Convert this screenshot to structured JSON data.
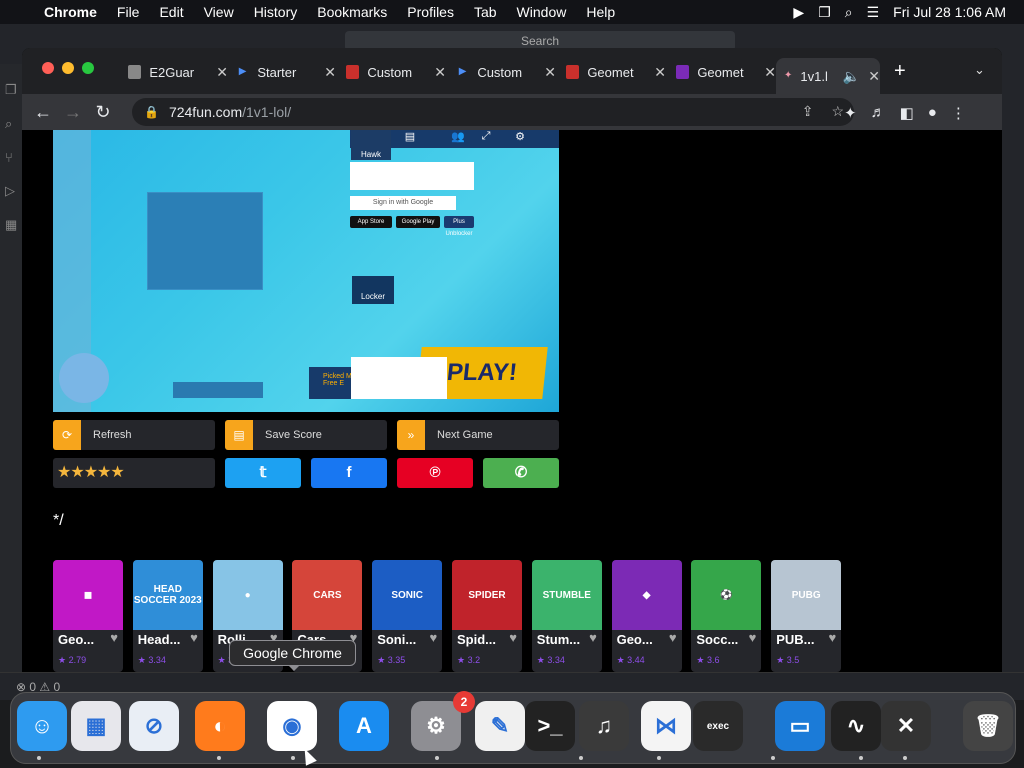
{
  "menubar": {
    "app": "Chrome",
    "items": [
      "File",
      "Edit",
      "View",
      "History",
      "Bookmarks",
      "Profiles",
      "Tab",
      "Window",
      "Help"
    ],
    "datetime": "Fri Jul 28  1:06 AM"
  },
  "bgapp": {
    "search_placeholder": "Search",
    "status": "⊗ 0 ⚠ 0"
  },
  "tabs": [
    {
      "title": "E2Guar",
      "icon": "globe-icon"
    },
    {
      "title": "Starter",
      "icon": "play-icon"
    },
    {
      "title": "Custom",
      "icon": "roblox-icon"
    },
    {
      "title": "Custom",
      "icon": "play-icon"
    },
    {
      "title": "Geomet",
      "icon": "roblox-icon"
    },
    {
      "title": "Geomet",
      "icon": "geometry-icon"
    },
    {
      "title": "1v1.l",
      "icon": "game-icon"
    }
  ],
  "url": {
    "host": "724fun.com",
    "path": "/1v1-lol/"
  },
  "game": {
    "avatar_label": "Hawk",
    "sign_in": "Sign in with Google",
    "app_store": "App Store",
    "google_play": "Google Play",
    "unblocker": "Plus Unblocker",
    "locker": "Locker",
    "play": "PLAY!",
    "picked": "Picked M Free E"
  },
  "controls": [
    {
      "label": "Refresh",
      "icon": "⟳"
    },
    {
      "label": "Save Score",
      "icon": "▤"
    },
    {
      "label": "Next Game",
      "icon": "»"
    }
  ],
  "stars": "★★★★★",
  "share": [
    {
      "name": "twitter",
      "icon": "🐦",
      "color": "#1da1f2"
    },
    {
      "name": "facebook",
      "icon": "f",
      "color": "#1877f2"
    },
    {
      "name": "pinterest",
      "icon": "℗",
      "color": "#e60023"
    },
    {
      "name": "whatsapp",
      "icon": "✆",
      "color": "#4caf50"
    }
  ],
  "comment": "*/",
  "games": [
    {
      "name": "Geo...",
      "rate": "★ 2.79",
      "color": "#c118c6",
      "art": "◼"
    },
    {
      "name": "Head...",
      "rate": "★ 3.34",
      "color": "#2f8ed8",
      "art": "HEAD SOCCER 2023"
    },
    {
      "name": "Rolli...",
      "rate": "★ 3.",
      "color": "#87c4e6",
      "art": "●"
    },
    {
      "name": "Cars...",
      "rate": "★ 3.",
      "color": "#d5453a",
      "art": "CARS"
    },
    {
      "name": "Soni...",
      "rate": "★ 3.35",
      "color": "#1c5dc4",
      "art": "SONIC"
    },
    {
      "name": "Spid...",
      "rate": "★ 3.2",
      "color": "#c0232b",
      "art": "SPIDER"
    },
    {
      "name": "Stum...",
      "rate": "★ 3.34",
      "color": "#3bb36c",
      "art": "STUMBLE"
    },
    {
      "name": "Geo...",
      "rate": "★ 3.44",
      "color": "#7c2ab5",
      "art": "◆"
    },
    {
      "name": "Socc...",
      "rate": "★ 3.6",
      "color": "#35a64a",
      "art": "⚽"
    },
    {
      "name": "PUB...",
      "rate": "★ 3.5",
      "color": "#b7c5d2",
      "art": "PUBG"
    }
  ],
  "tooltip": "Google Chrome",
  "dock": [
    {
      "name": "finder",
      "color": "#2e9bf0",
      "glyph": "☺"
    },
    {
      "name": "launchpad",
      "color": "#e7e7ec",
      "glyph": "▦"
    },
    {
      "name": "safari",
      "color": "#e9eef5",
      "glyph": "⊘"
    },
    {
      "name": "firefox",
      "color": "#ff7b1c",
      "glyph": "◐"
    },
    {
      "name": "chrome",
      "color": "#ffffff",
      "glyph": "◉"
    },
    {
      "name": "app-store",
      "color": "#1a8cf0",
      "glyph": "A"
    },
    {
      "name": "system-settings",
      "color": "#8e8e93",
      "glyph": "⚙"
    },
    {
      "name": "textedit",
      "color": "#f0f0f0",
      "glyph": "✎"
    },
    {
      "name": "terminal",
      "color": "#222",
      "glyph": ">_"
    },
    {
      "name": "garageband",
      "color": "#3a3a3a",
      "glyph": "♫"
    },
    {
      "name": "vscode",
      "color": "#f4f4f4",
      "glyph": "⋈"
    },
    {
      "name": "exec",
      "color": "#2a2a2a",
      "glyph": "exec"
    },
    {
      "name": "keynote",
      "color": "#1b7bd8",
      "glyph": "▭"
    },
    {
      "name": "activity-monitor",
      "color": "#222",
      "glyph": "∿"
    },
    {
      "name": "instruments",
      "color": "#333",
      "glyph": "✕"
    },
    {
      "name": "trash",
      "color": "#444",
      "glyph": "🗑"
    }
  ],
  "settings_badge": "2"
}
